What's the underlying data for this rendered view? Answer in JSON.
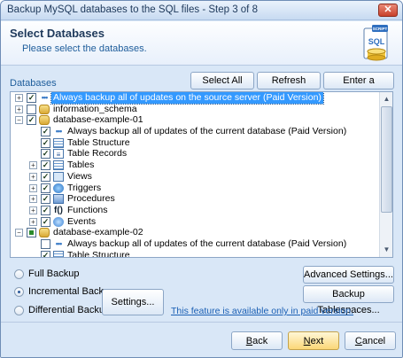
{
  "window": {
    "title": "Backup MySQL databases to the SQL files - Step 3 of 8",
    "close_label": "✕"
  },
  "header": {
    "title": "Select Databases",
    "subtitle": "Please select the databases.",
    "logo_top": "SCRIPT",
    "logo_text": "SQL"
  },
  "databases_label": "Databases",
  "toolbar": {
    "select_all": "Select All",
    "refresh": "Refresh",
    "enter_database": "Enter a database"
  },
  "tree": [
    {
      "level": 0,
      "expander": "+",
      "check": "checked",
      "icon": "dots-icon",
      "label": "Always backup all of updates on the source server  (Paid Version)",
      "selected": true
    },
    {
      "level": 0,
      "expander": "+",
      "check": "unchecked",
      "icon": "database-icon",
      "label": "information_schema"
    },
    {
      "level": 0,
      "expander": "-",
      "check": "checked",
      "icon": "database-icon",
      "label": "database-example-01"
    },
    {
      "level": 1,
      "expander": "",
      "check": "checked",
      "icon": "dots-icon",
      "label": "Always backup all of updates of the current database  (Paid Version)"
    },
    {
      "level": 1,
      "expander": "",
      "check": "checked",
      "icon": "table-structure-icon",
      "label": "Table Structure"
    },
    {
      "level": 1,
      "expander": "",
      "check": "checked",
      "icon": "table-records-icon",
      "label": "Table Records"
    },
    {
      "level": 1,
      "expander": "+",
      "check": "checked",
      "icon": "tables-icon",
      "label": "Tables"
    },
    {
      "level": 1,
      "expander": "+",
      "check": "checked",
      "icon": "views-icon",
      "label": "Views"
    },
    {
      "level": 1,
      "expander": "+",
      "check": "checked",
      "icon": "triggers-icon",
      "label": "Triggers"
    },
    {
      "level": 1,
      "expander": "+",
      "check": "checked",
      "icon": "procedures-icon",
      "label": "Procedures"
    },
    {
      "level": 1,
      "expander": "+",
      "check": "checked",
      "icon": "functions-icon",
      "label": "Functions"
    },
    {
      "level": 1,
      "expander": "+",
      "check": "checked",
      "icon": "events-icon",
      "label": "Events"
    },
    {
      "level": 0,
      "expander": "-",
      "check": "partial",
      "icon": "database-icon",
      "label": "database-example-02"
    },
    {
      "level": 1,
      "expander": "",
      "check": "unchecked",
      "icon": "dots-icon",
      "label": "Always backup all of updates of the current database  (Paid Version)"
    },
    {
      "level": 1,
      "expander": "",
      "check": "checked",
      "icon": "table-structure-icon",
      "label": "Table Structure"
    }
  ],
  "backup_mode": {
    "options": [
      {
        "label": "Full Backup",
        "checked": false
      },
      {
        "label": "Incremental Backup",
        "checked": true
      },
      {
        "label": "Differential Backup",
        "checked": false
      }
    ],
    "settings_label": "Settings...",
    "advanced_settings_label": "Advanced Settings...",
    "tablespaces_label": "Backup Tablespaces...",
    "paid_notice": "This feature is available only in paid version."
  },
  "footer": {
    "back": "Back",
    "next": "Next",
    "cancel": "Cancel"
  },
  "colors": {
    "accent": "#1e5d9b",
    "selection": "#3399ff",
    "window_bg": "#d9e7f7"
  }
}
